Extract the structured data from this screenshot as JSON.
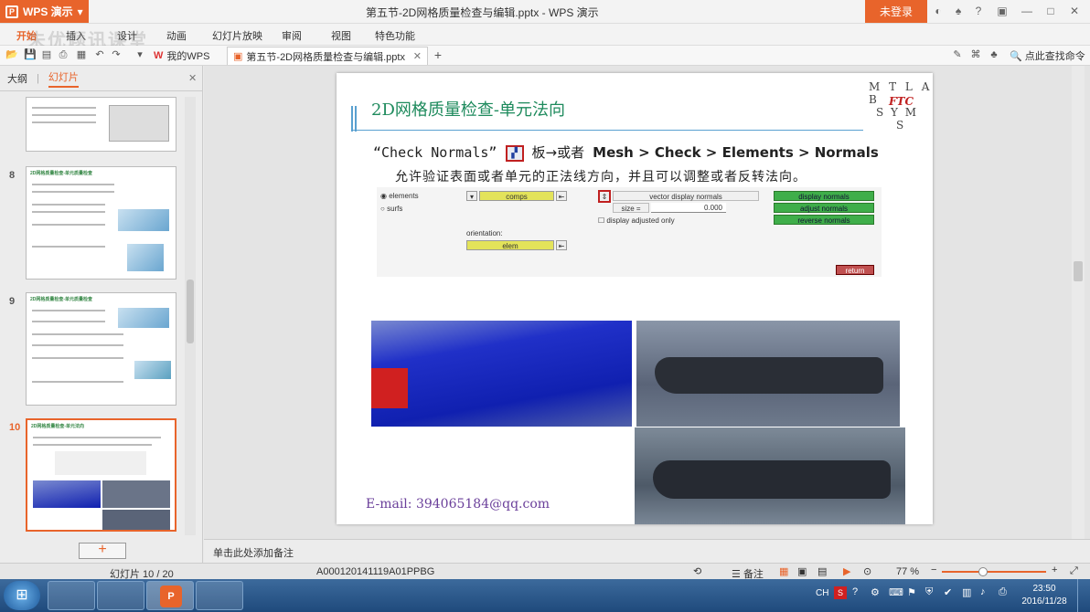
{
  "app": {
    "name": "WPS 演示",
    "window_title": "第五节-2D网格质量检查与编辑.pptx - WPS 演示",
    "login_label": "未登录"
  },
  "menu": [
    "开始",
    "插入",
    "设计",
    "动画",
    "幻灯片放映",
    "审阅",
    "视图",
    "特色功能"
  ],
  "watermark": "未优题讯课堂",
  "doc_tabs": [
    {
      "label": "我的WPS"
    },
    {
      "label": "第五节-2D网格质量检查与编辑.pptx"
    }
  ],
  "search_label": "点此查找命令",
  "left_panel": {
    "tab_outline": "大纲",
    "tab_slides": "幻灯片",
    "thumbs": [
      {
        "num": "8",
        "title": "2D网格质量检查-单元质量检查"
      },
      {
        "num": "9",
        "title": "2D网格质量检查-单元质量检查"
      },
      {
        "num": "10",
        "title": "2D网格质量检查-单元法向"
      }
    ],
    "add_button": "+"
  },
  "slide": {
    "title": "2D网格质量检查-单元法向",
    "logo": {
      "l1": "M  T L A B",
      "l2": "FTC",
      "l3": "S  Y  M",
      "l4": "S"
    },
    "cmd_prefix": "“Check Normals”",
    "cmd_mid": "板→或者",
    "cmd_path": "Mesh > Check > Elements > Normals",
    "description": "允许验证表面或者单元的正法线方向，并且可以调整或者反转法向。",
    "panel": {
      "radio1": "elements",
      "radio2": "surfs",
      "comps": "comps",
      "vector": "vector display normals",
      "size_label": "size =",
      "size_value": "0.000",
      "checkbox": "display adjusted only",
      "btn1": "display normals",
      "btn2": "adjust normals",
      "btn3": "reverse normals",
      "orientation": "orientation:",
      "elem": "elem",
      "return": "return"
    },
    "email": "E-mail: 394065184@qq.com"
  },
  "notes_placeholder": "单击此处添加备注",
  "status": {
    "slide_counter": "幻灯片 10 / 20",
    "template_id": "A000120141119A01PPBG",
    "notes_label": "备注",
    "zoom": "77 %"
  },
  "clock": {
    "time": "23:50",
    "date": "2016/11/28"
  },
  "tray": {
    "lang": "CH"
  }
}
